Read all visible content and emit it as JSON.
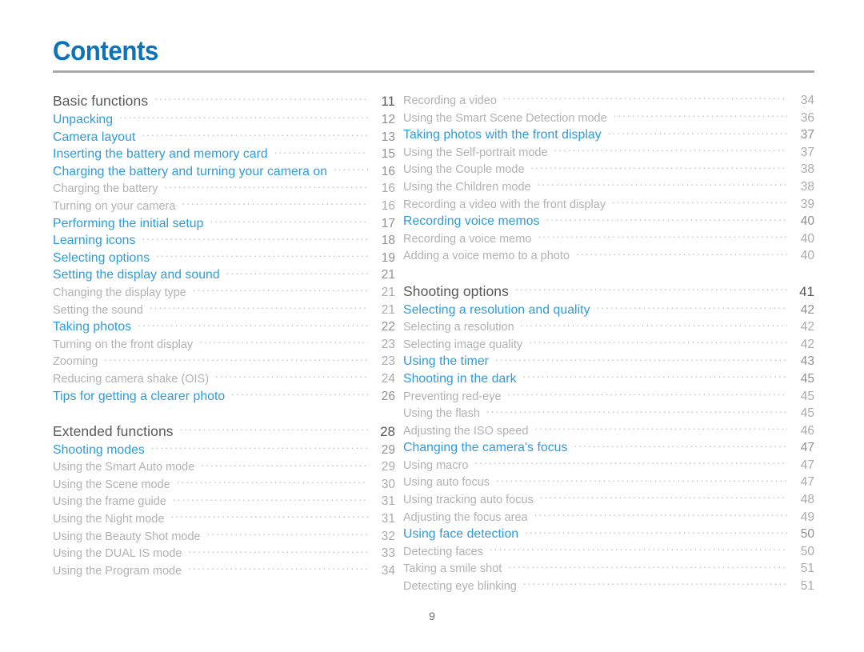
{
  "document": {
    "title": "Contents",
    "folio": "9"
  },
  "columns": {
    "left": [
      {
        "label": "Basic functions",
        "page": "11",
        "level": "section",
        "gap_before": false
      },
      {
        "label": "Unpacking",
        "page": "12",
        "level": "link",
        "gap_before": false
      },
      {
        "label": "Camera layout",
        "page": "13",
        "level": "link",
        "gap_before": false
      },
      {
        "label": "Inserting the battery and memory card",
        "page": "15",
        "level": "link",
        "gap_before": false
      },
      {
        "label": "Charging the battery and turning your camera on",
        "page": "16",
        "level": "link",
        "gap_before": false
      },
      {
        "label": "Charging the battery",
        "page": "16",
        "level": "sub",
        "gap_before": false
      },
      {
        "label": "Turning on your camera",
        "page": "16",
        "level": "sub",
        "gap_before": false
      },
      {
        "label": "Performing the initial setup",
        "page": "17",
        "level": "link",
        "gap_before": false
      },
      {
        "label": "Learning icons",
        "page": "18",
        "level": "link",
        "gap_before": false
      },
      {
        "label": "Selecting options",
        "page": "19",
        "level": "link",
        "gap_before": false
      },
      {
        "label": "Setting the display and sound",
        "page": "21",
        "level": "link",
        "gap_before": false
      },
      {
        "label": "Changing the display type",
        "page": "21",
        "level": "sub",
        "gap_before": false
      },
      {
        "label": "Setting the sound",
        "page": "21",
        "level": "sub",
        "gap_before": false
      },
      {
        "label": "Taking photos",
        "page": "22",
        "level": "link",
        "gap_before": false
      },
      {
        "label": "Turning on the front display",
        "page": "23",
        "level": "sub",
        "gap_before": false
      },
      {
        "label": "Zooming",
        "page": "23",
        "level": "sub",
        "gap_before": false
      },
      {
        "label": "Reducing camera shake (OIS)",
        "page": "24",
        "level": "sub",
        "gap_before": false
      },
      {
        "label": "Tips for getting a clearer photo",
        "page": "26",
        "level": "link",
        "gap_before": false
      },
      {
        "label": "Extended functions",
        "page": "28",
        "level": "section",
        "gap_before": true
      },
      {
        "label": "Shooting modes",
        "page": "29",
        "level": "link",
        "gap_before": false
      },
      {
        "label": "Using the Smart Auto mode",
        "page": "29",
        "level": "sub",
        "gap_before": false
      },
      {
        "label": "Using the Scene mode",
        "page": "30",
        "level": "sub",
        "gap_before": false
      },
      {
        "label": "Using the frame guide",
        "page": "31",
        "level": "sub",
        "gap_before": false
      },
      {
        "label": "Using the Night mode",
        "page": "31",
        "level": "sub",
        "gap_before": false
      },
      {
        "label": "Using the Beauty Shot mode",
        "page": "32",
        "level": "sub",
        "gap_before": false
      },
      {
        "label": "Using the DUAL IS mode",
        "page": "33",
        "level": "sub",
        "gap_before": false
      },
      {
        "label": "Using the Program mode",
        "page": "34",
        "level": "sub",
        "gap_before": false
      }
    ],
    "right": [
      {
        "label": "Recording a video",
        "page": "34",
        "level": "sub",
        "gap_before": false
      },
      {
        "label": "Using the Smart Scene Detection mode",
        "page": "36",
        "level": "sub",
        "gap_before": false
      },
      {
        "label": "Taking photos with the front display",
        "page": "37",
        "level": "link",
        "gap_before": false
      },
      {
        "label": "Using the Self-portrait mode",
        "page": "37",
        "level": "sub",
        "gap_before": false
      },
      {
        "label": "Using the Couple mode",
        "page": "38",
        "level": "sub",
        "gap_before": false
      },
      {
        "label": "Using the Children mode",
        "page": "38",
        "level": "sub",
        "gap_before": false
      },
      {
        "label": "Recording a video with the front display",
        "page": "39",
        "level": "sub",
        "gap_before": false
      },
      {
        "label": "Recording voice memos",
        "page": "40",
        "level": "link",
        "gap_before": false
      },
      {
        "label": "Recording a voice memo",
        "page": "40",
        "level": "sub",
        "gap_before": false
      },
      {
        "label": "Adding a voice memo to a photo",
        "page": "40",
        "level": "sub",
        "gap_before": false
      },
      {
        "label": "Shooting options",
        "page": "41",
        "level": "section",
        "gap_before": true
      },
      {
        "label": "Selecting a resolution and quality",
        "page": "42",
        "level": "link",
        "gap_before": false
      },
      {
        "label": "Selecting a resolution",
        "page": "42",
        "level": "sub",
        "gap_before": false
      },
      {
        "label": "Selecting image quality",
        "page": "42",
        "level": "sub",
        "gap_before": false
      },
      {
        "label": "Using the timer",
        "page": "43",
        "level": "link",
        "gap_before": false
      },
      {
        "label": "Shooting in the dark",
        "page": "45",
        "level": "link",
        "gap_before": false
      },
      {
        "label": "Preventing red-eye",
        "page": "45",
        "level": "sub",
        "gap_before": false
      },
      {
        "label": "Using the flash",
        "page": "45",
        "level": "sub",
        "gap_before": false
      },
      {
        "label": "Adjusting the ISO speed",
        "page": "46",
        "level": "sub",
        "gap_before": false
      },
      {
        "label": "Changing the camera's focus",
        "page": "47",
        "level": "link",
        "gap_before": false
      },
      {
        "label": "Using macro",
        "page": "47",
        "level": "sub",
        "gap_before": false
      },
      {
        "label": "Using auto focus",
        "page": "47",
        "level": "sub",
        "gap_before": false
      },
      {
        "label": "Using tracking auto focus",
        "page": "48",
        "level": "sub",
        "gap_before": false
      },
      {
        "label": "Adjusting the focus area",
        "page": "49",
        "level": "sub",
        "gap_before": false
      },
      {
        "label": "Using face detection",
        "page": "50",
        "level": "link",
        "gap_before": false
      },
      {
        "label": "Detecting faces",
        "page": "50",
        "level": "sub",
        "gap_before": false
      },
      {
        "label": "Taking a smile shot",
        "page": "51",
        "level": "sub",
        "gap_before": false
      },
      {
        "label": "Detecting eye blinking",
        "page": "51",
        "level": "sub",
        "gap_before": false
      }
    ]
  },
  "colors": {
    "title_blue": "#0d73b8",
    "link_blue": "#2e9bd9",
    "section_gray": "#58595b",
    "sub_gray": "#b0b2b5",
    "rule_gray": "#a7a9ac"
  }
}
